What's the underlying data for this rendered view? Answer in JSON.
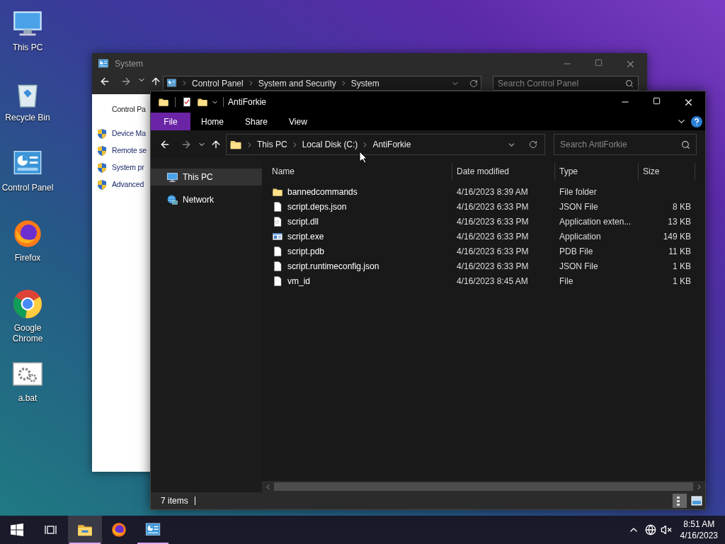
{
  "desktop_icons": [
    {
      "label": "This PC",
      "kind": "pc"
    },
    {
      "label": "Recycle Bin",
      "kind": "bin"
    },
    {
      "label": "Control Panel",
      "kind": "panel"
    },
    {
      "label": "Firefox",
      "kind": "firefox"
    },
    {
      "label": "Google Chrome",
      "kind": "chrome"
    },
    {
      "label": "a.bat",
      "kind": "bat"
    }
  ],
  "background_window": {
    "title": "System",
    "breadcrumb": [
      "Control Panel",
      "System and Security",
      "System"
    ],
    "search": {
      "placeholder": "Search Control Panel"
    },
    "heading": "Control Pa",
    "links": [
      "Device Ma",
      "Remote se",
      "System pr",
      "Advanced"
    ]
  },
  "explorer": {
    "title": "AntiForkie",
    "ribbon_tabs": [
      {
        "label": "File",
        "kind": "file"
      },
      {
        "label": "Home",
        "kind": "tab"
      },
      {
        "label": "Share",
        "kind": "tab"
      },
      {
        "label": "View",
        "kind": "tab"
      }
    ],
    "breadcrumb": [
      "This PC",
      "Local Disk (C:)",
      "AntiForkie"
    ],
    "search": {
      "placeholder": "Search AntiForkie"
    },
    "nav_items": [
      {
        "label": "This PC",
        "kind": "pc",
        "selected": true
      },
      {
        "label": "Network",
        "kind": "network",
        "selected": false
      }
    ],
    "columns": [
      "Name",
      "Date modified",
      "Type",
      "Size"
    ],
    "rows": [
      {
        "name": "bannedcommands",
        "date": "4/16/2023 8:39 AM",
        "type": "File folder",
        "size": "",
        "kind": "folder"
      },
      {
        "name": "script.deps.json",
        "date": "4/16/2023 6:33 PM",
        "type": "JSON File",
        "size": "8 KB",
        "kind": "file"
      },
      {
        "name": "script.dll",
        "date": "4/16/2023 6:33 PM",
        "type": "Application exten...",
        "size": "13 KB",
        "kind": "dll"
      },
      {
        "name": "script.exe",
        "date": "4/16/2023 6:33 PM",
        "type": "Application",
        "size": "149 KB",
        "kind": "exe"
      },
      {
        "name": "script.pdb",
        "date": "4/16/2023 6:33 PM",
        "type": "PDB File",
        "size": "11 KB",
        "kind": "file"
      },
      {
        "name": "script.runtimeconfig.json",
        "date": "4/16/2023 6:33 PM",
        "type": "JSON File",
        "size": "1 KB",
        "kind": "file"
      },
      {
        "name": "vm_id",
        "date": "4/16/2023 8:45 AM",
        "type": "File",
        "size": "1 KB",
        "kind": "file"
      }
    ],
    "status": "7 items"
  },
  "taskbar": {
    "apps": [
      {
        "kind": "explorer",
        "active": true,
        "running": true
      },
      {
        "kind": "firefox",
        "active": false,
        "running": false
      },
      {
        "kind": "panel",
        "active": false,
        "running": true
      }
    ],
    "time": "8:51 AM",
    "date": "4/16/2023"
  }
}
